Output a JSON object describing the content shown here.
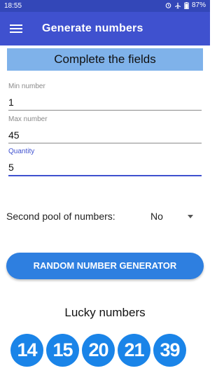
{
  "status_bar": {
    "time": "18:55",
    "battery": "87%",
    "icons": [
      "alarm-icon",
      "airplane-icon",
      "battery-icon"
    ]
  },
  "app_bar": {
    "title": "Generate numbers",
    "menu_icon": "menu-icon"
  },
  "banner": {
    "text": "Complete the fields"
  },
  "fields": {
    "min": {
      "label": "Min number",
      "value": "1"
    },
    "max": {
      "label": "Max number",
      "value": "45"
    },
    "quantity": {
      "label": "Quantity",
      "value": "5"
    }
  },
  "second_pool": {
    "label": "Second pool of numbers:",
    "selected": "No"
  },
  "generate_button": {
    "label": "RANDOM NUMBER GENERATOR"
  },
  "results": {
    "title": "Lucky numbers",
    "numbers": [
      "14",
      "15",
      "20",
      "21",
      "39"
    ]
  },
  "colors": {
    "status_bar": "#3347b8",
    "app_bar": "#3f51cf",
    "banner": "#7fb2ea",
    "button": "#2e7fe0",
    "ball": "#1a84e8"
  }
}
